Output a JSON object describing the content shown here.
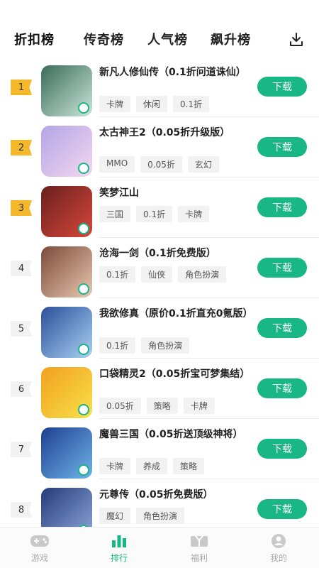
{
  "tabs": [
    {
      "label": "折扣榜",
      "active": true
    },
    {
      "label": "传奇榜",
      "active": false
    },
    {
      "label": "人气榜",
      "active": false
    },
    {
      "label": "飙升榜",
      "active": false
    }
  ],
  "download_icon": "download-icon",
  "games": [
    {
      "rank": "1",
      "title": "新凡人修仙传（0.1折问道诛仙）",
      "tags": [
        "卡牌",
        "休闲",
        "0.1折"
      ],
      "button": "下载",
      "colors": [
        "#3a6b5a",
        "#c9e6d8"
      ]
    },
    {
      "rank": "2",
      "title": "太古神王2（0.05折升级版）",
      "tags": [
        "MMO",
        "0.05折",
        "玄幻"
      ],
      "button": "下载",
      "colors": [
        "#b3a6e6",
        "#f4d6f0"
      ]
    },
    {
      "rank": "3",
      "title": "笑梦江山",
      "tags": [
        "三国",
        "0.1折",
        "卡牌"
      ],
      "button": "下载",
      "colors": [
        "#6a1f1f",
        "#d6473b"
      ]
    },
    {
      "rank": "4",
      "title": "沧海一剑（0.1折免费版）",
      "tags": [
        "0.1折",
        "仙侠",
        "角色扮演"
      ],
      "button": "下载",
      "colors": [
        "#7a4b3a",
        "#e8c7b0"
      ]
    },
    {
      "rank": "5",
      "title": "我欲修真（原价0.1折直充0氪版）",
      "tags": [
        "0.1折",
        "角色扮演"
      ],
      "button": "下载",
      "colors": [
        "#2a4f9a",
        "#a9d1f2"
      ]
    },
    {
      "rank": "6",
      "title": "口袋精灵2（0.05折宝可梦集结）",
      "tags": [
        "0.05折",
        "策略",
        "卡牌"
      ],
      "button": "下载",
      "colors": [
        "#f2a01f",
        "#f7e04a"
      ]
    },
    {
      "rank": "7",
      "title": "魔兽三国（0.05折送顶级神将）",
      "tags": [
        "卡牌",
        "养成",
        "策略"
      ],
      "button": "下载",
      "colors": [
        "#1d3f8f",
        "#6fb3e9"
      ]
    },
    {
      "rank": "8",
      "title": "元尊传（0.05折免费版）",
      "tags": [
        "魔幻",
        "角色扮演"
      ],
      "button": "下载",
      "colors": [
        "#243a7a",
        "#8fa9d9"
      ]
    }
  ],
  "nav": [
    {
      "label": "游戏",
      "icon": "gamepad-icon",
      "active": false
    },
    {
      "label": "排行",
      "icon": "ranking-icon",
      "active": true
    },
    {
      "label": "福利",
      "icon": "gift-icon",
      "active": false
    },
    {
      "label": "我的",
      "icon": "user-icon",
      "active": false
    }
  ],
  "accent": "#18b784",
  "rank_gold": "#f6b82b"
}
